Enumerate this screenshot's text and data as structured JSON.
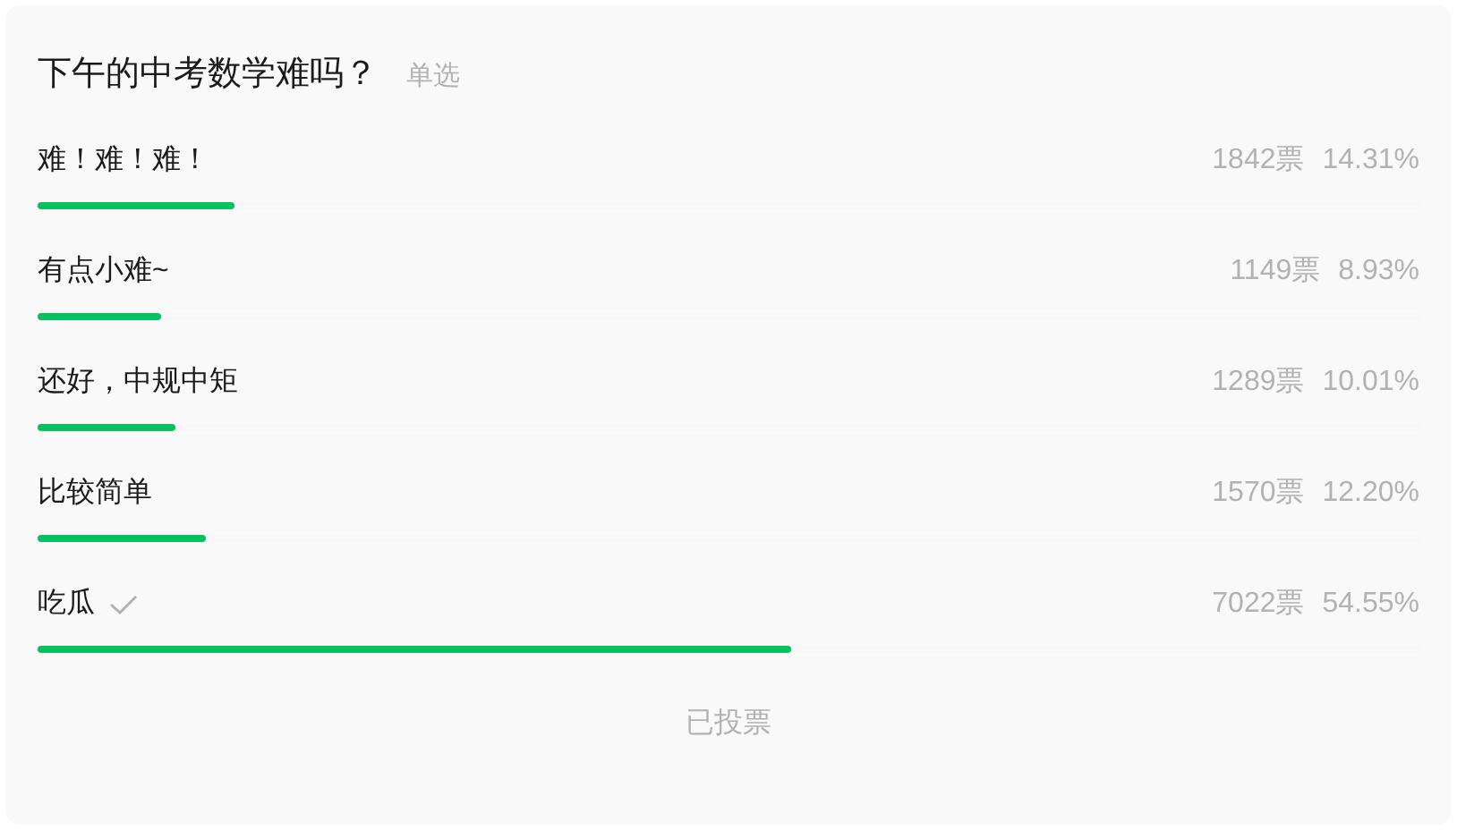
{
  "poll": {
    "question": "下午的中考数学难吗？",
    "type_label": "单选",
    "options": [
      {
        "label": "难！难！难！",
        "votes": "1842票",
        "percent": "14.31%",
        "level": 0.1431,
        "selected": false
      },
      {
        "label": "有点小难~",
        "votes": "1149票",
        "percent": "8.93%",
        "level": 0.0893,
        "selected": false
      },
      {
        "label": "还好，中规中矩",
        "votes": "1289票",
        "percent": "10.01%",
        "level": 0.1001,
        "selected": false
      },
      {
        "label": "比较简单",
        "votes": "1570票",
        "percent": "12.20%",
        "level": 0.122,
        "selected": false
      },
      {
        "label": "吃瓜",
        "votes": "7022票",
        "percent": "54.55%",
        "level": 0.5455,
        "selected": true
      }
    ],
    "status": "已投票"
  }
}
